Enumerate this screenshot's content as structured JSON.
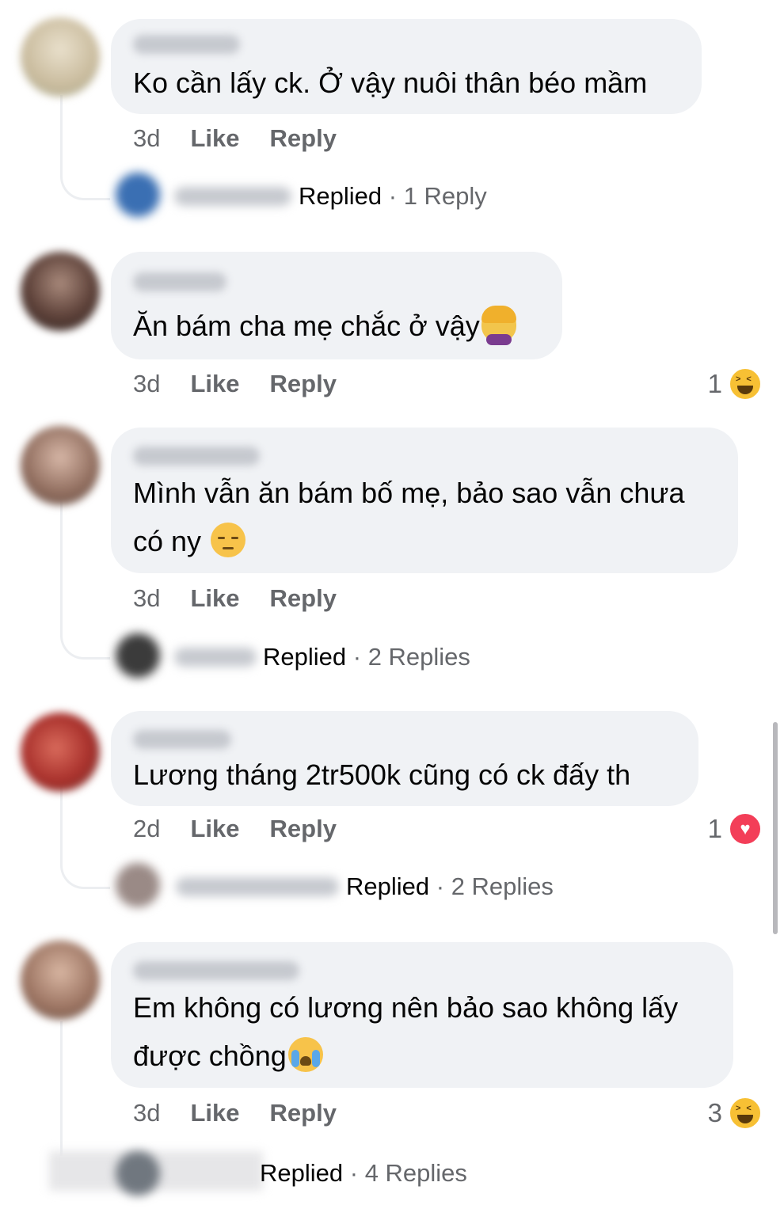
{
  "comments": [
    {
      "text": "Ko cần lấy ck. Ở vậy nuôi thân béo mầm",
      "time": "3d",
      "like": "Like",
      "reply": "Reply",
      "replied": {
        "label": "Replied",
        "sep": " · ",
        "count": "1 Reply"
      }
    },
    {
      "text": "Ăn bám cha mẹ chắc ở vậy",
      "emoji": "face-palm-woman-emoji",
      "time": "3d",
      "like": "Like",
      "reply": "Reply",
      "reaction": {
        "count": "1",
        "type": "haha"
      }
    },
    {
      "text_line1": "Mình vẫn ăn bám bố mẹ, bảo sao vẫn chưa",
      "text_line2": "có ny",
      "emoji": "pensive-face-emoji",
      "time": "3d",
      "like": "Like",
      "reply": "Reply",
      "replied": {
        "label": "Replied",
        "sep": " · ",
        "count": "2 Replies"
      }
    },
    {
      "text": "Lương tháng 2tr500k cũng có ck đấy th",
      "time": "2d",
      "like": "Like",
      "reply": "Reply",
      "reaction": {
        "count": "1",
        "type": "love"
      },
      "replied": {
        "label": "Replied",
        "sep": " · ",
        "count": "2 Replies"
      }
    },
    {
      "text_line1": "Em không có lương nên bảo sao không lấy",
      "text_line2": "được chồng",
      "emoji": "crying-face-emoji",
      "time": "3d",
      "like": "Like",
      "reply": "Reply",
      "reaction": {
        "count": "3",
        "type": "haha"
      },
      "replied": {
        "label": "Replied",
        "sep": " · ",
        "count": "4 Replies"
      }
    }
  ],
  "colors": {
    "bubble": "#f0f2f5",
    "meta": "#65676b",
    "text": "#050505",
    "haha": "#f7c034",
    "love": "#f33e58"
  }
}
